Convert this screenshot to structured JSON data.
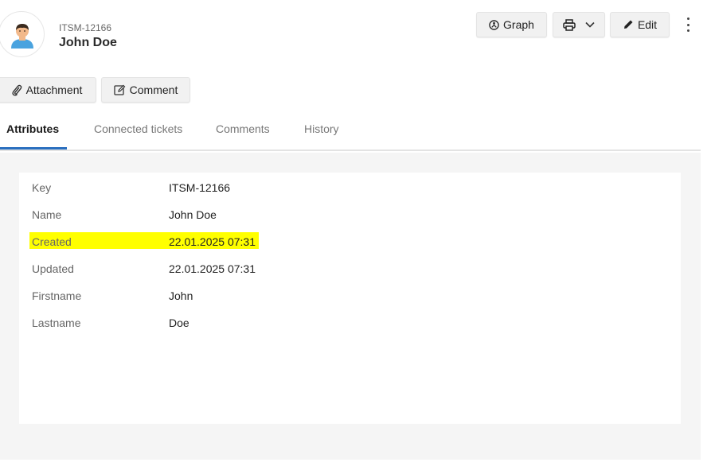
{
  "header": {
    "key": "ITSM-12166",
    "title": "John Doe"
  },
  "toolbar": {
    "graph_label": "Graph",
    "edit_label": "Edit"
  },
  "actions": {
    "attachment_label": "Attachment",
    "comment_label": "Comment"
  },
  "tabs": [
    {
      "label": "Attributes",
      "active": true
    },
    {
      "label": "Connected tickets",
      "active": false
    },
    {
      "label": "Comments",
      "active": false
    },
    {
      "label": "History",
      "active": false
    }
  ],
  "attributes": [
    {
      "label": "Key",
      "value": "ITSM-12166",
      "highlighted": false
    },
    {
      "label": "Name",
      "value": "John Doe",
      "highlighted": false
    },
    {
      "label": "Created",
      "value": "22.01.2025 07:31",
      "highlighted": true
    },
    {
      "label": "Updated",
      "value": "22.01.2025 07:31",
      "highlighted": false
    },
    {
      "label": "Firstname",
      "value": "John",
      "highlighted": false
    },
    {
      "label": "Lastname",
      "value": "Doe",
      "highlighted": false
    }
  ],
  "colors": {
    "accent": "#2a6fbf",
    "highlight": "#ffff00"
  },
  "icons": {
    "avatar": "person-avatar-icon",
    "graph": "graph-icon",
    "print": "printer-icon",
    "dropdown": "chevron-down-icon",
    "edit": "pencil-icon",
    "attachment": "paperclip-icon",
    "comment": "comment-edit-icon",
    "more": "more-vertical-icon"
  }
}
